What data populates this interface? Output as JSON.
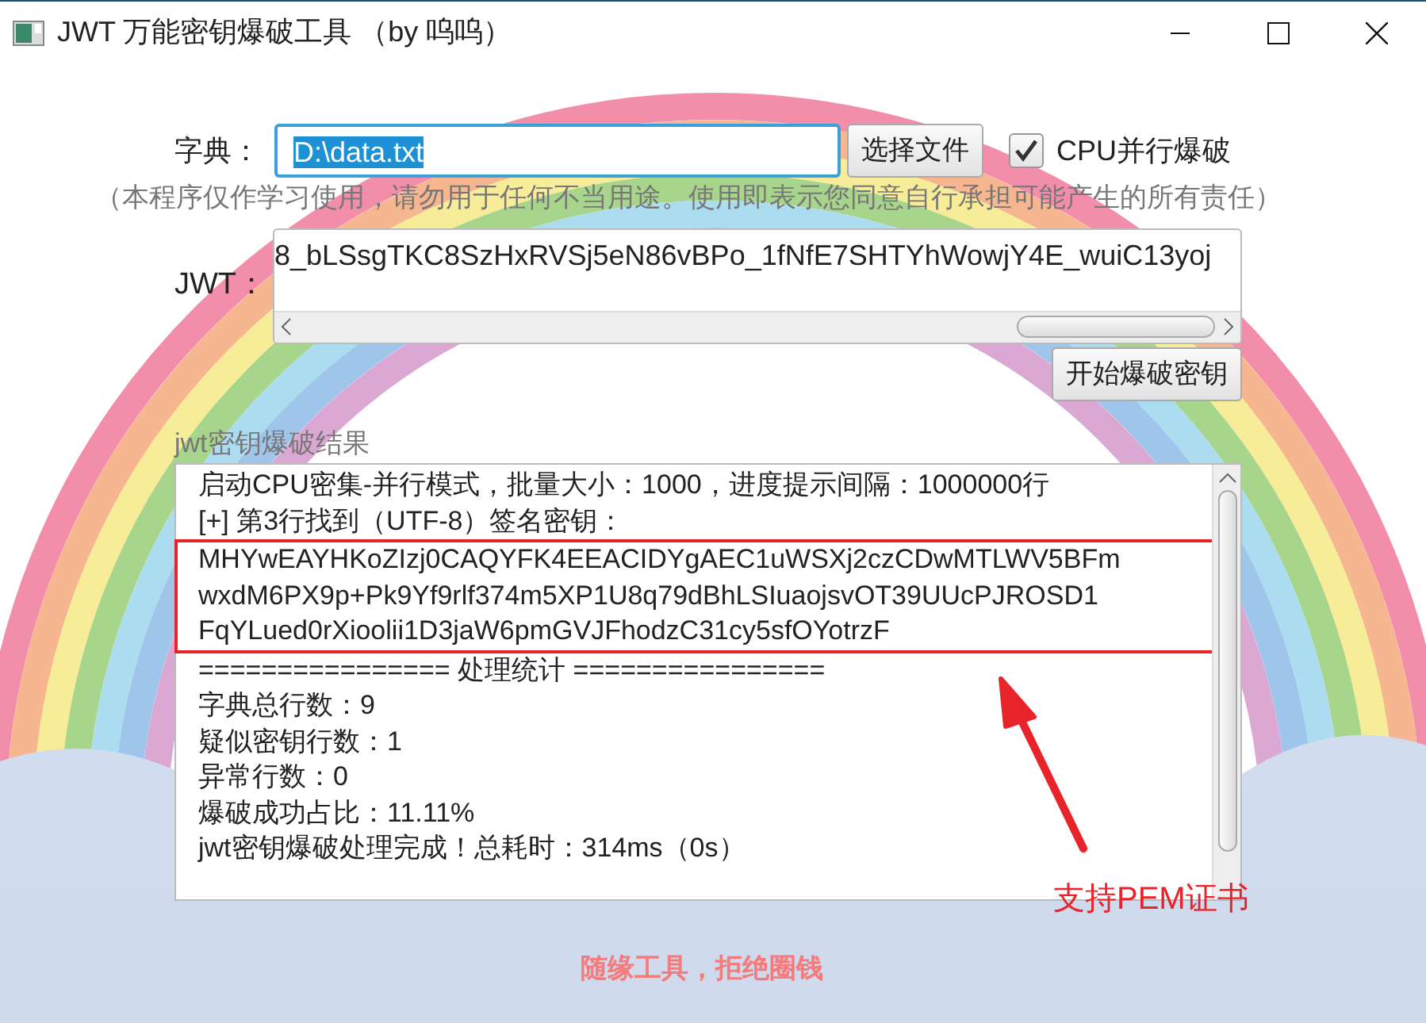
{
  "window": {
    "title": "JWT 万能密钥爆破工具 （by 呜呜）"
  },
  "dictionary": {
    "label": "字典：",
    "value": "D:\\data.txt",
    "browse_button": "选择文件"
  },
  "parallel": {
    "label": "CPU并行爆破",
    "checked": true
  },
  "disclaimer": "（本程序仅作学习使用，请勿用于任何不当用途。使用即表示您同意自行承担可能产生的所有责任）",
  "jwt": {
    "label": "JWT：",
    "value": "8_bLSsgTKC8SzHxRVSj5eN86vBPo_1fNfE7SHTYhWowjY4E_wuiC13yoj"
  },
  "start_button": "开始爆破密钥",
  "result": {
    "label": "jwt密钥爆破结果",
    "lines": [
      {
        "text": "启动CPU密集-并行模式，批量大小：1000，进度提示间隔：1000000行",
        "boxed": false
      },
      {
        "text": "[+] 第3行找到（UTF-8）签名密钥：",
        "boxed": false
      },
      {
        "text": "MHYwEAYHKoZIzj0CAQYFK4EEACIDYgAEC1uWSXj2czCDwMTLWV5BFm",
        "boxed": true
      },
      {
        "text": "wxdM6PX9p+Pk9Yf9rlf374m5XP1U8q79dBhLSIuaojsvOT39UUcPJROSD1",
        "boxed": true
      },
      {
        "text": "FqYLued0rXioolii1D3jaW6pmGVJFhodzC31cy5sfOYotrzF",
        "boxed": true
      },
      {
        "text": "================ 处理统计 ================",
        "boxed": false
      },
      {
        "text": "字典总行数：9",
        "boxed": false
      },
      {
        "text": "疑似密钥行数：1",
        "boxed": false
      },
      {
        "text": "异常行数：0",
        "boxed": false
      },
      {
        "text": "爆破成功占比：11.11%",
        "boxed": false
      },
      {
        "text": "jwt密钥爆破处理完成！总耗时：314ms（0s）",
        "boxed": false
      }
    ]
  },
  "annotation": {
    "text": "支持PEM证书"
  },
  "footer": "随缘工具，拒绝圈钱"
}
